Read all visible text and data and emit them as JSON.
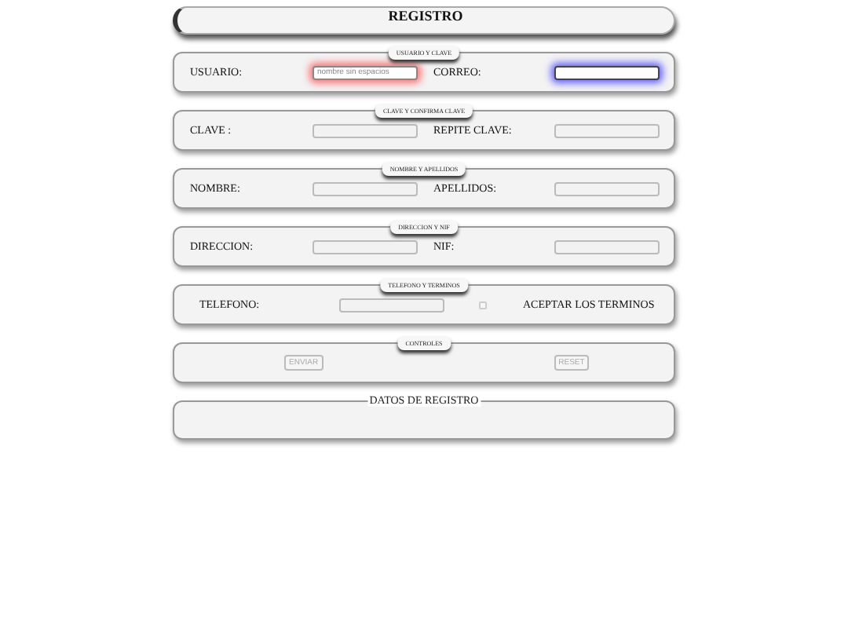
{
  "title": "REGISTRO",
  "sections": [
    {
      "kind": "pair",
      "legend": "USUARIO Y CLAVE",
      "items": [
        {
          "label": "USUARIO:",
          "field": {
            "placeholder": "nombre sin espacios",
            "invalid": true,
            "focused": false
          }
        },
        {
          "label": "CORREO:",
          "field": {
            "invalid": false,
            "focused": true
          }
        }
      ]
    },
    {
      "kind": "pair",
      "legend": "CLAVE Y CONFIRMA CLAVE",
      "items": [
        {
          "label": "CLAVE :",
          "field": {
            "invalid": false,
            "focused": false
          }
        },
        {
          "label": "REPITE CLAVE:",
          "field": {
            "invalid": false,
            "focused": false
          }
        }
      ]
    },
    {
      "kind": "pair",
      "legend": "NOMBRE Y APELLIDOS",
      "items": [
        {
          "label": "NOMBRE:",
          "field": {
            "invalid": false,
            "focused": false
          }
        },
        {
          "label": "APELLIDOS:",
          "field": {
            "invalid": false,
            "focused": false
          }
        }
      ]
    },
    {
      "kind": "pair",
      "legend": "DIRECCION Y NIF",
      "items": [
        {
          "label": "DIRECCION:",
          "field": {
            "invalid": false,
            "focused": false
          }
        },
        {
          "label": "NIF:",
          "field": {
            "invalid": false,
            "focused": false
          }
        }
      ]
    },
    {
      "kind": "terms",
      "legend": "TELEFONO Y TERMINOS",
      "label": "TELEFONO:",
      "field": {
        "invalid": false,
        "focused": false
      },
      "checkbox": {
        "checked": false,
        "label": "ACEPTAR LOS TERMINOS"
      }
    },
    {
      "kind": "buttons",
      "legend": "CONTROLES",
      "buttons": [
        {
          "label": "ENVIAR",
          "disabled": true
        },
        {
          "label": "RESET",
          "disabled": true
        }
      ]
    },
    {
      "kind": "output",
      "legend": "DATOS DE REGISTRO"
    }
  ]
}
